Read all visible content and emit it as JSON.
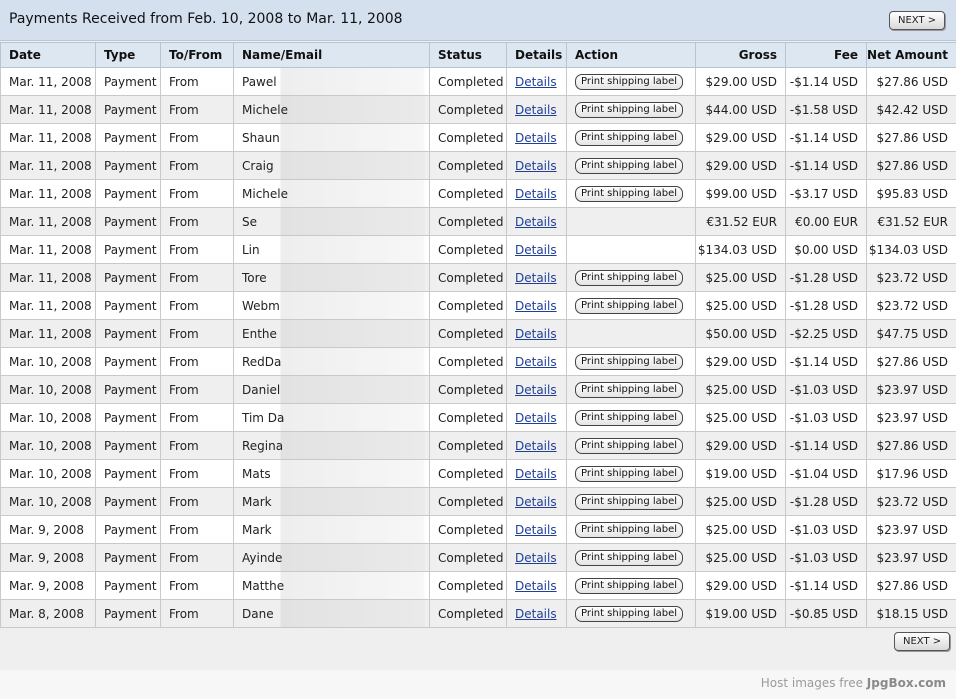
{
  "page": {
    "title": "Payments Received from Feb. 10, 2008 to Mar. 11, 2008",
    "next_label": "NEXT >"
  },
  "columns": [
    "Date",
    "Type",
    "To/From",
    "Name/Email",
    "Status",
    "Details",
    "Action",
    "Gross",
    "Fee",
    "Net Amount"
  ],
  "rows": [
    {
      "date": "Mar. 11, 2008",
      "type": "Payment",
      "tofrom": "From",
      "name": "Pawel",
      "status": "Completed",
      "details": "Details",
      "action": "Print shipping label",
      "gross": "$29.00 USD",
      "fee": "-$1.14 USD",
      "net": "$27.86 USD"
    },
    {
      "date": "Mar. 11, 2008",
      "type": "Payment",
      "tofrom": "From",
      "name": "Michele",
      "status": "Completed",
      "details": "Details",
      "action": "Print shipping label",
      "gross": "$44.00 USD",
      "fee": "-$1.58 USD",
      "net": "$42.42 USD"
    },
    {
      "date": "Mar. 11, 2008",
      "type": "Payment",
      "tofrom": "From",
      "name": "Shaun",
      "status": "Completed",
      "details": "Details",
      "action": "Print shipping label",
      "gross": "$29.00 USD",
      "fee": "-$1.14 USD",
      "net": "$27.86 USD"
    },
    {
      "date": "Mar. 11, 2008",
      "type": "Payment",
      "tofrom": "From",
      "name": "Craig",
      "status": "Completed",
      "details": "Details",
      "action": "Print shipping label",
      "gross": "$29.00 USD",
      "fee": "-$1.14 USD",
      "net": "$27.86 USD"
    },
    {
      "date": "Mar. 11, 2008",
      "type": "Payment",
      "tofrom": "From",
      "name": "Michele",
      "status": "Completed",
      "details": "Details",
      "action": "Print shipping label",
      "gross": "$99.00 USD",
      "fee": "-$3.17 USD",
      "net": "$95.83 USD"
    },
    {
      "date": "Mar. 11, 2008",
      "type": "Payment",
      "tofrom": "From",
      "name": "Se",
      "status": "Completed",
      "details": "Details",
      "action": "",
      "gross": "€31.52 EUR",
      "fee": "€0.00 EUR",
      "net": "€31.52 EUR"
    },
    {
      "date": "Mar. 11, 2008",
      "type": "Payment",
      "tofrom": "From",
      "name": "Lin",
      "status": "Completed",
      "details": "Details",
      "action": "",
      "gross": "$134.03 USD",
      "fee": "$0.00 USD",
      "net": "$134.03 USD"
    },
    {
      "date": "Mar. 11, 2008",
      "type": "Payment",
      "tofrom": "From",
      "name": "Tore",
      "status": "Completed",
      "details": "Details",
      "action": "Print shipping label",
      "gross": "$25.00 USD",
      "fee": "-$1.28 USD",
      "net": "$23.72 USD"
    },
    {
      "date": "Mar. 11, 2008",
      "type": "Payment",
      "tofrom": "From",
      "name": "Webm",
      "status": "Completed",
      "details": "Details",
      "action": "Print shipping label",
      "gross": "$25.00 USD",
      "fee": "-$1.28 USD",
      "net": "$23.72 USD"
    },
    {
      "date": "Mar. 11, 2008",
      "type": "Payment",
      "tofrom": "From",
      "name": "Enthe",
      "status": "Completed",
      "details": "Details",
      "action": "",
      "gross": "$50.00 USD",
      "fee": "-$2.25 USD",
      "net": "$47.75 USD"
    },
    {
      "date": "Mar. 10, 2008",
      "type": "Payment",
      "tofrom": "From",
      "name": "RedDa",
      "status": "Completed",
      "details": "Details",
      "action": "Print shipping label",
      "gross": "$29.00 USD",
      "fee": "-$1.14 USD",
      "net": "$27.86 USD"
    },
    {
      "date": "Mar. 10, 2008",
      "type": "Payment",
      "tofrom": "From",
      "name": "Daniel",
      "status": "Completed",
      "details": "Details",
      "action": "Print shipping label",
      "gross": "$25.00 USD",
      "fee": "-$1.03 USD",
      "net": "$23.97 USD"
    },
    {
      "date": "Mar. 10, 2008",
      "type": "Payment",
      "tofrom": "From",
      "name": "Tim Da",
      "status": "Completed",
      "details": "Details",
      "action": "Print shipping label",
      "gross": "$25.00 USD",
      "fee": "-$1.03 USD",
      "net": "$23.97 USD"
    },
    {
      "date": "Mar. 10, 2008",
      "type": "Payment",
      "tofrom": "From",
      "name": "Regina",
      "status": "Completed",
      "details": "Details",
      "action": "Print shipping label",
      "gross": "$29.00 USD",
      "fee": "-$1.14 USD",
      "net": "$27.86 USD"
    },
    {
      "date": "Mar. 10, 2008",
      "type": "Payment",
      "tofrom": "From",
      "name": "Mats",
      "status": "Completed",
      "details": "Details",
      "action": "Print shipping label",
      "gross": "$19.00 USD",
      "fee": "-$1.04 USD",
      "net": "$17.96 USD"
    },
    {
      "date": "Mar. 10, 2008",
      "type": "Payment",
      "tofrom": "From",
      "name": "Mark",
      "status": "Completed",
      "details": "Details",
      "action": "Print shipping label",
      "gross": "$25.00 USD",
      "fee": "-$1.28 USD",
      "net": "$23.72 USD"
    },
    {
      "date": "Mar. 9, 2008",
      "type": "Payment",
      "tofrom": "From",
      "name": "Mark",
      "status": "Completed",
      "details": "Details",
      "action": "Print shipping label",
      "gross": "$25.00 USD",
      "fee": "-$1.03 USD",
      "net": "$23.97 USD"
    },
    {
      "date": "Mar. 9, 2008",
      "type": "Payment",
      "tofrom": "From",
      "name": "Ayinde",
      "status": "Completed",
      "details": "Details",
      "action": "Print shipping label",
      "gross": "$25.00 USD",
      "fee": "-$1.03 USD",
      "net": "$23.97 USD"
    },
    {
      "date": "Mar. 9, 2008",
      "type": "Payment",
      "tofrom": "From",
      "name": "Matthe",
      "status": "Completed",
      "details": "Details",
      "action": "Print shipping label",
      "gross": "$29.00 USD",
      "fee": "-$1.14 USD",
      "net": "$27.86 USD"
    },
    {
      "date": "Mar. 8, 2008",
      "type": "Payment",
      "tofrom": "From",
      "name": "Dane",
      "status": "Completed",
      "details": "Details",
      "action": "Print shipping label",
      "gross": "$19.00 USD",
      "fee": "-$0.85 USD",
      "net": "$18.15 USD"
    }
  ],
  "footer": {
    "text": "Host images free",
    "brand": "JpgBox.com"
  }
}
